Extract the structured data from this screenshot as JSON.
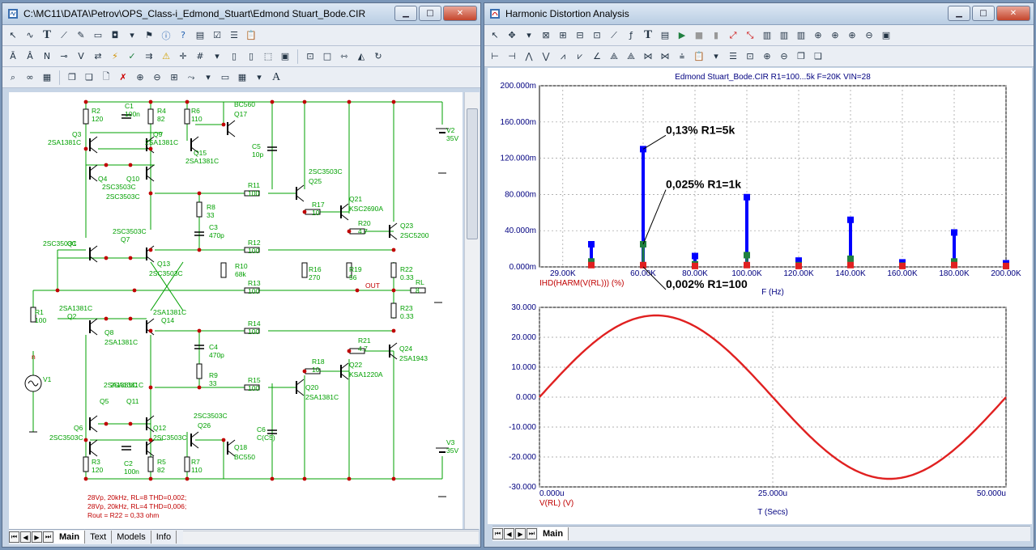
{
  "left_window": {
    "title": "C:\\MC11\\DATA\\Petrov\\OPS_Class-i_Edmond_Stuart\\Edmond Stuart_Bode.CIR",
    "tabs": [
      "Main",
      "Text",
      "Models",
      "Info"
    ],
    "active_tab": "Main"
  },
  "right_window": {
    "title": "Harmonic Distortion Analysis",
    "tabs": [
      "Main"
    ],
    "active_tab": "Main"
  },
  "window_buttons": {
    "minimize": "▁",
    "maximize": "□",
    "close": "✕"
  },
  "schematic": {
    "components": [
      {
        "id": "R2",
        "value": "120"
      },
      {
        "id": "C1",
        "value": "100n"
      },
      {
        "id": "R4",
        "value": "82"
      },
      {
        "id": "R6",
        "value": "110"
      },
      {
        "id": "Q17",
        "value": "BC560"
      },
      {
        "id": "Q3",
        "value": "2SA1381C"
      },
      {
        "id": "Q9",
        "value": "2SA1381C"
      },
      {
        "id": "Q15",
        "value": "2SA1381C"
      },
      {
        "id": "C5",
        "value": "10p"
      },
      {
        "id": "V2",
        "value": "35V"
      },
      {
        "id": "Q4",
        "value": "2SC3503C"
      },
      {
        "id": "Q10",
        "value": "2SC3503C"
      },
      {
        "id": "R11",
        "value": "100"
      },
      {
        "id": "Q25",
        "value": "2SC3503C"
      },
      {
        "id": "R8",
        "value": "33"
      },
      {
        "id": "C3",
        "value": "470p"
      },
      {
        "id": "R17",
        "value": "10"
      },
      {
        "id": "Q21",
        "value": "KSC2690A"
      },
      {
        "id": "R20",
        "value": "4.7"
      },
      {
        "id": "Q23",
        "value": "2SC5200"
      },
      {
        "id": "Q1",
        "value": "2SC3503C"
      },
      {
        "id": "Q7",
        "value": "2SC3503C"
      },
      {
        "id": "R12",
        "value": "100"
      },
      {
        "id": "Q13",
        "value": "2SC3503C"
      },
      {
        "id": "R10",
        "value": "68k"
      },
      {
        "id": "R16",
        "value": "270"
      },
      {
        "id": "R19",
        "value": "56"
      },
      {
        "id": "R22",
        "value": "0.33"
      },
      {
        "id": "R13",
        "value": "100"
      },
      {
        "id": "RL",
        "value": "8"
      },
      {
        "id": "R1",
        "value": "100"
      },
      {
        "id": "Q2",
        "value": "2SA1381C"
      },
      {
        "id": "Q14",
        "value": "2SA1381C"
      },
      {
        "id": "R23",
        "value": "0.33"
      },
      {
        "id": "Q8",
        "value": "2SA1381C"
      },
      {
        "id": "R14",
        "value": "100"
      },
      {
        "id": "C4",
        "value": "470p"
      },
      {
        "id": "R9",
        "value": "33"
      },
      {
        "id": "R21",
        "value": "4.7"
      },
      {
        "id": "Q24",
        "value": "2SA1943"
      },
      {
        "id": "V1",
        "value": ""
      },
      {
        "id": "R18",
        "value": "10"
      },
      {
        "id": "Q22",
        "value": "KSA1220A"
      },
      {
        "id": "Q5",
        "value": "2SA1381C"
      },
      {
        "id": "Q11",
        "value": "2SA1381C"
      },
      {
        "id": "R15",
        "value": "100"
      },
      {
        "id": "Q20",
        "value": "2SA1381C"
      },
      {
        "id": "Q6",
        "value": "2SC3503C"
      },
      {
        "id": "Q12",
        "value": "2SC3503C"
      },
      {
        "id": "Q26",
        "value": "2SC3503C"
      },
      {
        "id": "C6",
        "value": "C(C5)"
      },
      {
        "id": "V3",
        "value": "35V"
      },
      {
        "id": "Q18",
        "value": "BC550"
      },
      {
        "id": "R3",
        "value": "120"
      },
      {
        "id": "C2",
        "value": "100n"
      },
      {
        "id": "R5",
        "value": "82"
      },
      {
        "id": "R7",
        "value": "110"
      }
    ],
    "net_labels": {
      "out": "OUT",
      "input_node": "n"
    },
    "notes": [
      "28Vp, 20kHz, RL=8 THD=0,002;",
      "28Vp, 20kHz, RL=4 THD=0,006;",
      "Rout = R22 = 0,33 ohm"
    ]
  },
  "chart_data": [
    {
      "type": "bar",
      "title": "Edmond Stuart_Bode.CIR R1=100...5k F=20K VIN=28",
      "xlabel": "F (Hz)",
      "ylabel": "IHD(HARM(V(RL))) (%)",
      "x_ticks": [
        "29.00K",
        "60.00K",
        "80.00K",
        "100.00K",
        "120.00K",
        "140.00K",
        "160.00K",
        "180.00K",
        "200.00K"
      ],
      "y_ticks": [
        "0.000m",
        "40.000m",
        "80.000m",
        "120.000m",
        "160.000m",
        "200.000m"
      ],
      "xlim": [
        20000,
        200000
      ],
      "ylim": [
        0,
        0.2
      ],
      "grid": true,
      "x": [
        40000,
        60000,
        80000,
        100000,
        120000,
        140000,
        160000,
        180000,
        200000
      ],
      "series": [
        {
          "name": "R1=5k",
          "color": "#0000ff",
          "values": [
            0.025,
            0.13,
            0.012,
            0.077,
            0.007,
            0.052,
            0.005,
            0.038,
            0.004
          ]
        },
        {
          "name": "R1=1k",
          "color": "#208040",
          "values": [
            0.006,
            0.025,
            0.003,
            0.013,
            0.002,
            0.009,
            0.0015,
            0.006,
            0.001
          ]
        },
        {
          "name": "R1=100",
          "color": "#e02020",
          "values": [
            0.002,
            0.002,
            0.001,
            0.002,
            0.001,
            0.002,
            0.001,
            0.002,
            0.001
          ]
        }
      ],
      "annotations": [
        "0,13% R1=5k",
        "0,025% R1=1k",
        "0,002% R1=100"
      ],
      "axis_color": "#000080",
      "ylabel_color": "#c00000"
    },
    {
      "type": "line",
      "xlabel": "T (Secs)",
      "ylabel": "V(RL) (V)",
      "x_ticks": [
        "0.000u",
        "25.000u",
        "50.000u"
      ],
      "y_ticks": [
        "-30.000",
        "-20.000",
        "-10.000",
        "0.000",
        "10.000",
        "20.000",
        "30.000"
      ],
      "xlim": [
        0,
        50
      ],
      "ylim": [
        -30,
        30
      ],
      "grid": true,
      "series": [
        {
          "name": "V(RL)",
          "color": "#e02020",
          "amplitude": 27.3,
          "period_us": 50
        },
        {
          "name": "",
          "color": "#2030d0",
          "amplitude": 27.3,
          "period_us": 50
        }
      ]
    }
  ]
}
